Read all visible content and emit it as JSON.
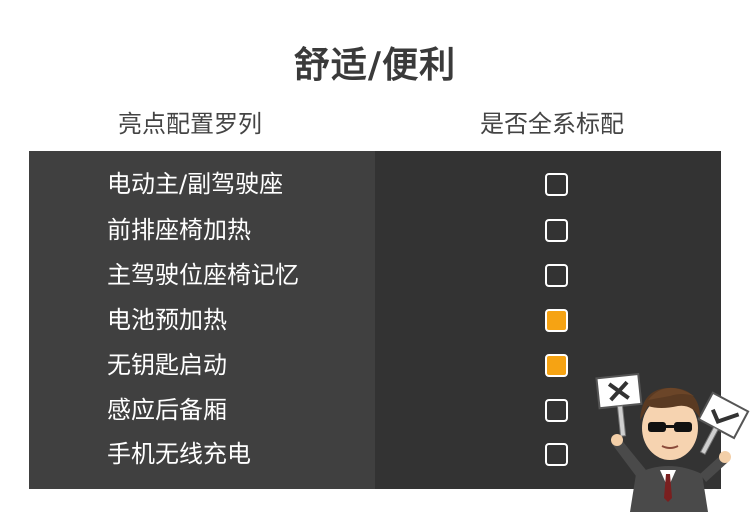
{
  "title": "舒适/便利",
  "headers": {
    "feature": "亮点配置罗列",
    "standard": "是否全系标配"
  },
  "rows": [
    {
      "label": "电动主/副驾驶座",
      "standard": false
    },
    {
      "label": "前排座椅加热",
      "standard": false
    },
    {
      "label": "主驾驶位座椅记忆",
      "standard": false
    },
    {
      "label": "电池预加热",
      "standard": true
    },
    {
      "label": "无钥匙启动",
      "standard": true
    },
    {
      "label": "感应后备厢",
      "standard": false
    },
    {
      "label": "手机无线充电",
      "standard": false
    }
  ],
  "colors": {
    "checked": "#f6a313",
    "table_left": "#404040",
    "table_right": "#333333"
  }
}
